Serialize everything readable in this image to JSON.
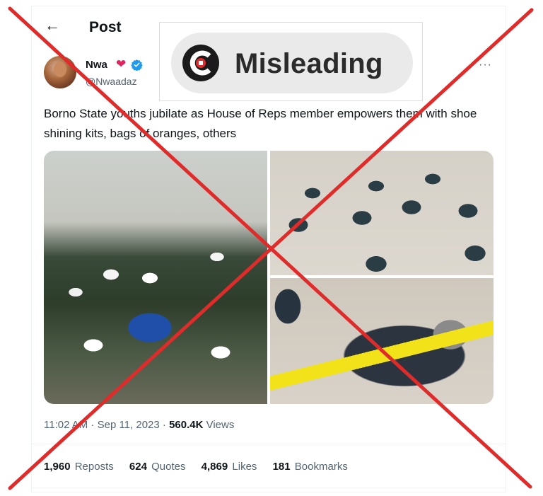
{
  "header": {
    "title": "Post",
    "back_icon": "back-arrow-icon"
  },
  "author": {
    "display_name": "Nwa",
    "handle": "@Nwaadaz",
    "heart_icon": "red-heart-icon",
    "verified_icon": "verified-badge-icon",
    "verified_color": "#1d9bf0"
  },
  "tweet": {
    "text": "Borno State youths jubilate as House of Reps member empowers them with shoe shining kits, bags of oranges, others",
    "time": "11:02 AM · Sep 11, 2023 · ",
    "views_count": "560.4K",
    "views_label": " Views"
  },
  "stats": [
    {
      "count": "1,960",
      "label": "Reposts"
    },
    {
      "count": "624",
      "label": "Quotes"
    },
    {
      "count": "4,869",
      "label": "Likes"
    },
    {
      "count": "181",
      "label": "Bookmarks"
    }
  ],
  "fact_check": {
    "rating": "Misleading",
    "logo_icon": "factcheck-logo-icon",
    "cross_color": "#e02b2b"
  },
  "colors": {
    "text_primary": "#0f1419",
    "text_secondary": "#536471"
  }
}
